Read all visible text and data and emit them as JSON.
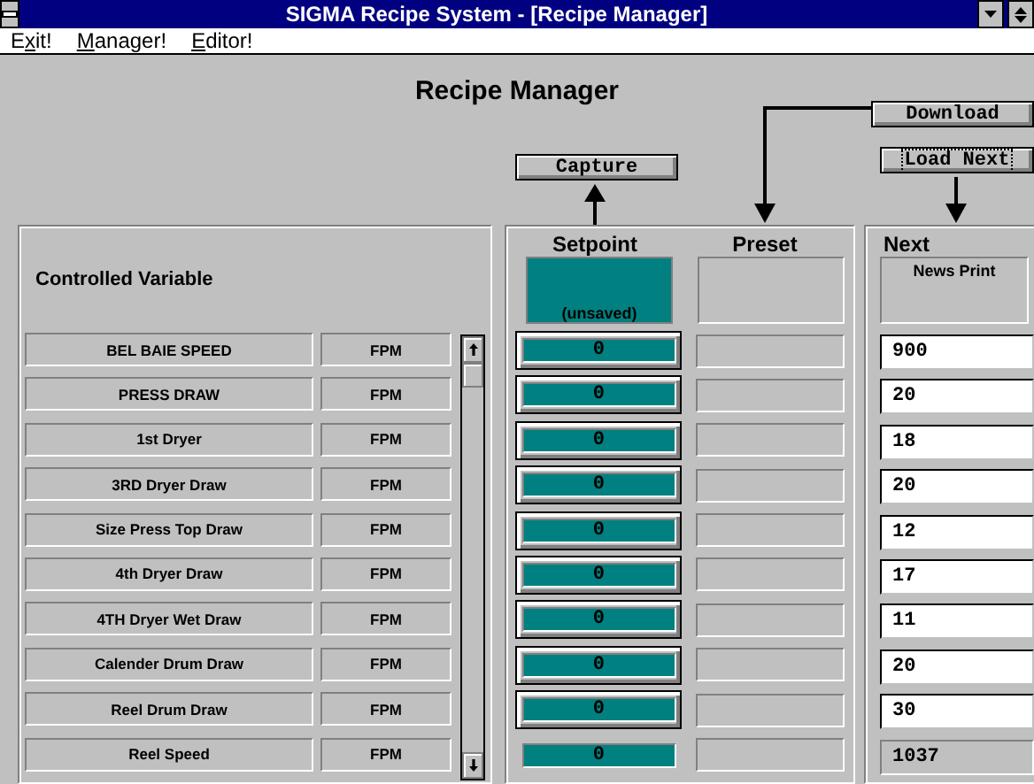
{
  "window": {
    "title": "SIGMA Recipe System - [Recipe Manager]"
  },
  "menu": [
    {
      "before": "E",
      "mnemonic": "x",
      "after": "it!"
    },
    {
      "mnemonic": "M",
      "after": "anager!"
    },
    {
      "mnemonic": "E",
      "after": "ditor!"
    }
  ],
  "heading": "Recipe Manager",
  "buttons": {
    "download": {
      "label": "Download",
      "focused": false
    },
    "capture": {
      "label": "Capture",
      "focused": false
    },
    "load_next": {
      "label": "Load Next",
      "focused": true
    }
  },
  "columns": {
    "variable": "Controlled Variable",
    "setpoint": "Setpoint",
    "setpoint_note": "(unsaved)",
    "preset": "Preset",
    "next": "Next",
    "next_recipe": "News Print"
  },
  "rows": [
    {
      "name": "BEL BAIE SPEED",
      "unit": "FPM",
      "setpoint": {
        "kind": "button",
        "value": "0"
      },
      "next": "900",
      "next_disabled": false
    },
    {
      "name": "PRESS DRAW",
      "unit": "FPM",
      "setpoint": {
        "kind": "button",
        "value": "0"
      },
      "next": "20",
      "next_disabled": false
    },
    {
      "name": "1st Dryer",
      "unit": "FPM",
      "setpoint": {
        "kind": "button",
        "value": "0"
      },
      "next": "18",
      "next_disabled": false
    },
    {
      "name": "3RD Dryer Draw",
      "unit": "FPM",
      "setpoint": {
        "kind": "button",
        "value": "0"
      },
      "next": "20",
      "next_disabled": false
    },
    {
      "name": "Size Press Top Draw",
      "unit": "FPM",
      "setpoint": {
        "kind": "button",
        "value": "0"
      },
      "next": "12",
      "next_disabled": false
    },
    {
      "name": "4th Dryer Draw",
      "unit": "FPM",
      "setpoint": {
        "kind": "button",
        "value": "0"
      },
      "next": "17",
      "next_disabled": false
    },
    {
      "name": "4TH Dryer Wet Draw",
      "unit": "FPM",
      "setpoint": {
        "kind": "button",
        "value": "0"
      },
      "next": "11",
      "next_disabled": false
    },
    {
      "name": "Calender Drum Draw",
      "unit": "FPM",
      "setpoint": {
        "kind": "button",
        "value": "0"
      },
      "next": "20",
      "next_disabled": false
    },
    {
      "name": "Reel Drum Draw",
      "unit": "FPM",
      "setpoint": {
        "kind": "button",
        "value": "0"
      },
      "next": "30",
      "next_disabled": false
    },
    {
      "name": "Reel Speed",
      "unit": "FPM",
      "setpoint": {
        "kind": "plain",
        "value": "0"
      },
      "next": "1037",
      "next_disabled": true
    }
  ]
}
